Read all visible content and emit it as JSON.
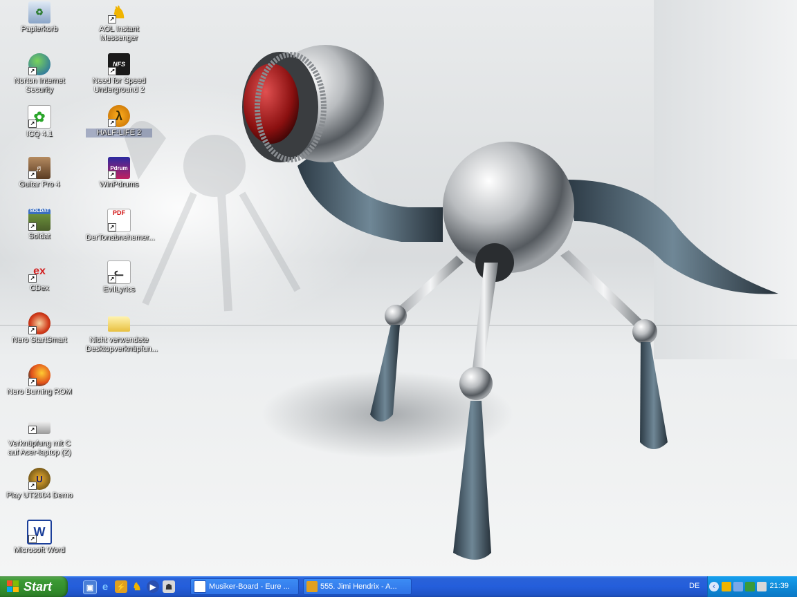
{
  "desktop_icons": {
    "col1": [
      {
        "label": "Papierkorb",
        "icon": "recycle-bin-icon"
      },
      {
        "label": "Norton Internet Security",
        "icon": "globe-icon"
      },
      {
        "label": "ICQ 4.1",
        "icon": "flower-icon"
      },
      {
        "label": "Guitar Pro 4",
        "icon": "guitar-icon"
      },
      {
        "label": "Soldat",
        "icon": "soldier-icon"
      },
      {
        "label": "CDex",
        "icon": "cd-icon"
      },
      {
        "label": "Nero StartSmart",
        "icon": "nero-flame-icon"
      },
      {
        "label": "Nero Burning ROM",
        "icon": "burning-cd-icon"
      },
      {
        "label": "Verknüpfung mit C auf Acer-laptop (Z)",
        "icon": "network-drive-icon"
      },
      {
        "label": "Play UT2004 Demo",
        "icon": "ut-icon"
      },
      {
        "label": "Microsoft Word",
        "icon": "word-icon"
      }
    ],
    "col2": [
      {
        "label": "AOL Instant Messenger",
        "icon": "running-man-icon"
      },
      {
        "label": "Need for Speed Underground 2",
        "icon": "nfs-icon"
      },
      {
        "label": "HALF-LIFE 2",
        "icon": "lambda-icon"
      },
      {
        "label": "WinPdrums",
        "icon": "drums-icon"
      },
      {
        "label": "DerTonabnehemer...",
        "icon": "pdf-icon"
      },
      {
        "label": "EvilLyrics",
        "icon": "cat-icon"
      },
      {
        "label": "Nicht verwendete Desktopverknüpfun...",
        "icon": "folder-icon"
      }
    ]
  },
  "taskbar": {
    "start_label": "Start",
    "tasks": [
      {
        "label": "Musiker-Board - Eure ..."
      },
      {
        "label": "555. Jimi Hendrix - A..."
      }
    ],
    "language": "DE",
    "clock": "21:39"
  },
  "colors": {
    "taskbar_blue": "#245edb",
    "start_green": "#3c9a34",
    "tray_blue": "#0e8ad8"
  }
}
